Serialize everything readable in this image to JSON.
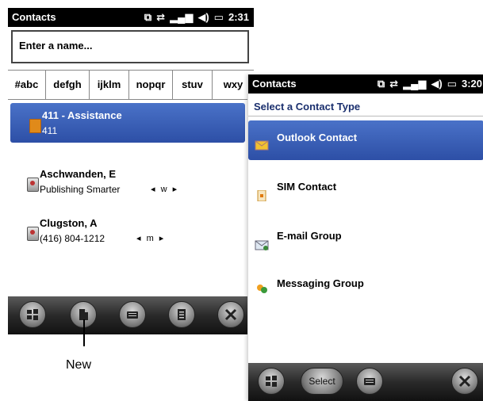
{
  "screen1": {
    "title": "Contacts",
    "status_time": "2:31",
    "search": {
      "placeholder": "Enter a name..."
    },
    "letter_tabs": [
      "#abc",
      "defgh",
      "ijklm",
      "nopqr",
      "stuv",
      "wxy"
    ],
    "contacts": [
      {
        "name": "411 - Assistance",
        "detail": "411",
        "nav": "",
        "selected": true
      },
      {
        "name": "Aschwanden, E",
        "detail": "Publishing Smarter",
        "nav": "◂ w ▸",
        "selected": false
      },
      {
        "name": "Clugston, A",
        "detail": "(416) 804-1212",
        "nav": "◂ m ▸",
        "selected": false
      }
    ],
    "callout_label": "New"
  },
  "screen2": {
    "title": "Contacts",
    "status_time": "3:20",
    "subtitle": "Select a Contact Type",
    "types": [
      {
        "label": "Outlook Contact",
        "icon": "outlook-contact-icon",
        "selected": true
      },
      {
        "label": "SIM Contact",
        "icon": "sim-card-icon",
        "selected": false
      },
      {
        "label": "E-mail Group",
        "icon": "email-group-icon",
        "selected": false
      },
      {
        "label": "Messaging Group",
        "icon": "messaging-group-icon",
        "selected": false
      }
    ],
    "select_button": "Select"
  },
  "colors": {
    "selection": "#2d4fa6",
    "titlebar": "#000000",
    "subtitle": "#1a2f6e"
  }
}
